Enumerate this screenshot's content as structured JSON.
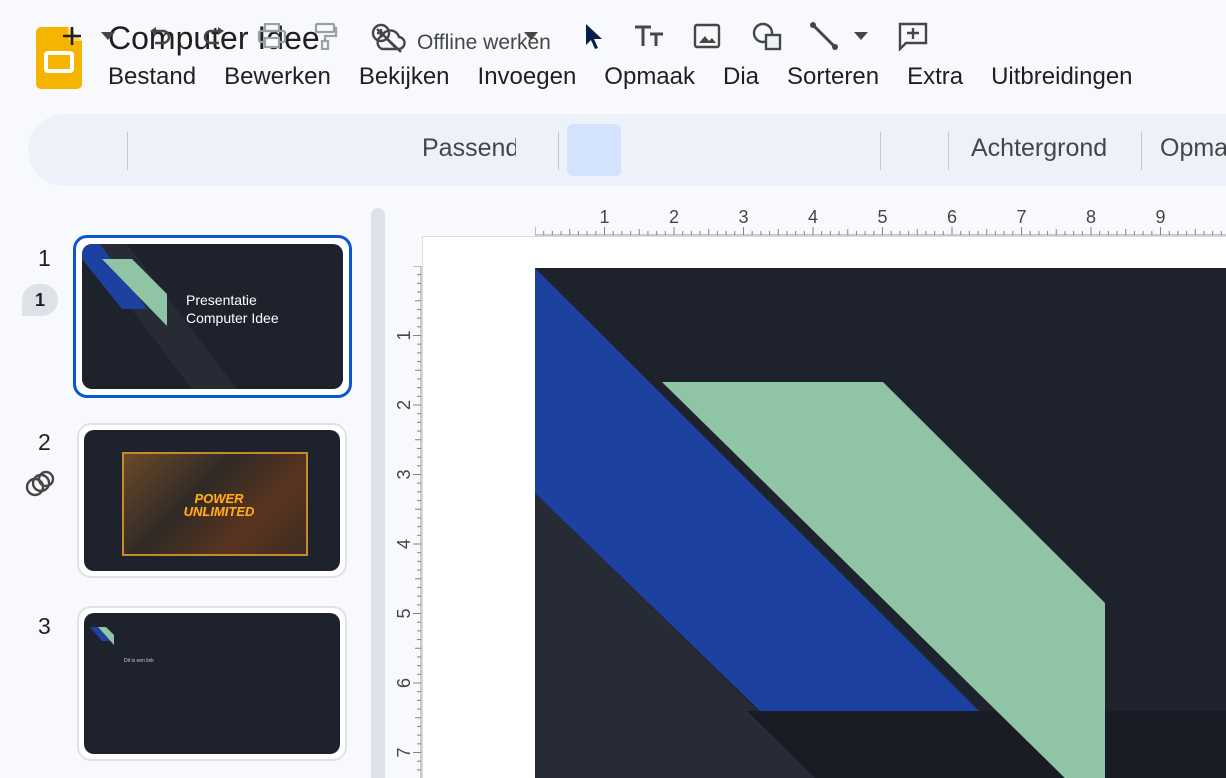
{
  "document": {
    "title": "Computer Idee",
    "status": "Offline werken"
  },
  "menu": [
    "Bestand",
    "Bewerken",
    "Bekijken",
    "Invoegen",
    "Opmaak",
    "Dia",
    "Sorteren",
    "Extra",
    "Uitbreidingen"
  ],
  "toolbar": {
    "zoom": "Passend",
    "background_label": "Achtergrond",
    "layout_label": "Opmaak"
  },
  "filmstrip": {
    "slides": [
      {
        "number": "1",
        "title_line1": "Presentatie",
        "title_line2": "Computer Idee",
        "badge": "1"
      },
      {
        "number": "2",
        "image_caption": "POWER UNLIMITED"
      },
      {
        "number": "3",
        "text": "Dit is een link"
      }
    ]
  },
  "rulers": {
    "horizontal": [
      "1",
      "2",
      "3",
      "4",
      "5",
      "6",
      "7",
      "8",
      "9",
      "1"
    ],
    "vertical": [
      "1",
      "2",
      "3",
      "4",
      "5",
      "6",
      "7"
    ]
  },
  "colors": {
    "accent": "#0b57d0",
    "slide_bg": "#1e222c",
    "blue_band": "#1c41a0",
    "green_band": "#8fc5a5",
    "toolbar_bg": "#edf2fa",
    "selected_tool": "#d3e3fd"
  }
}
